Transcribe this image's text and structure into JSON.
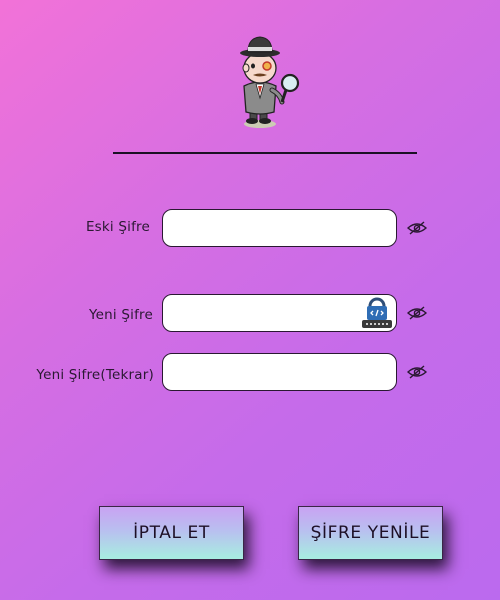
{
  "fields": [
    {
      "label": "Eski Şifre",
      "value": "",
      "placeholder": ""
    },
    {
      "label": "Yeni Şifre",
      "value": "",
      "placeholder": ""
    },
    {
      "label": "Yeni Şifre(Tekrar)",
      "value": "",
      "placeholder": ""
    }
  ],
  "icons": {
    "mascot": "detective-mascot",
    "toggle": "eye-slash-icon",
    "password_manager": "password-manager-icon"
  },
  "buttons": {
    "cancel_label": "İPTAL ET",
    "renew_label": "ŞİFRE YENİLE"
  },
  "colors": {
    "background_start": "#f272d8",
    "background_end": "#bb6aee",
    "button_top": "#c9a3f2",
    "button_bottom": "#a7efe0",
    "text": "#2a1832"
  }
}
